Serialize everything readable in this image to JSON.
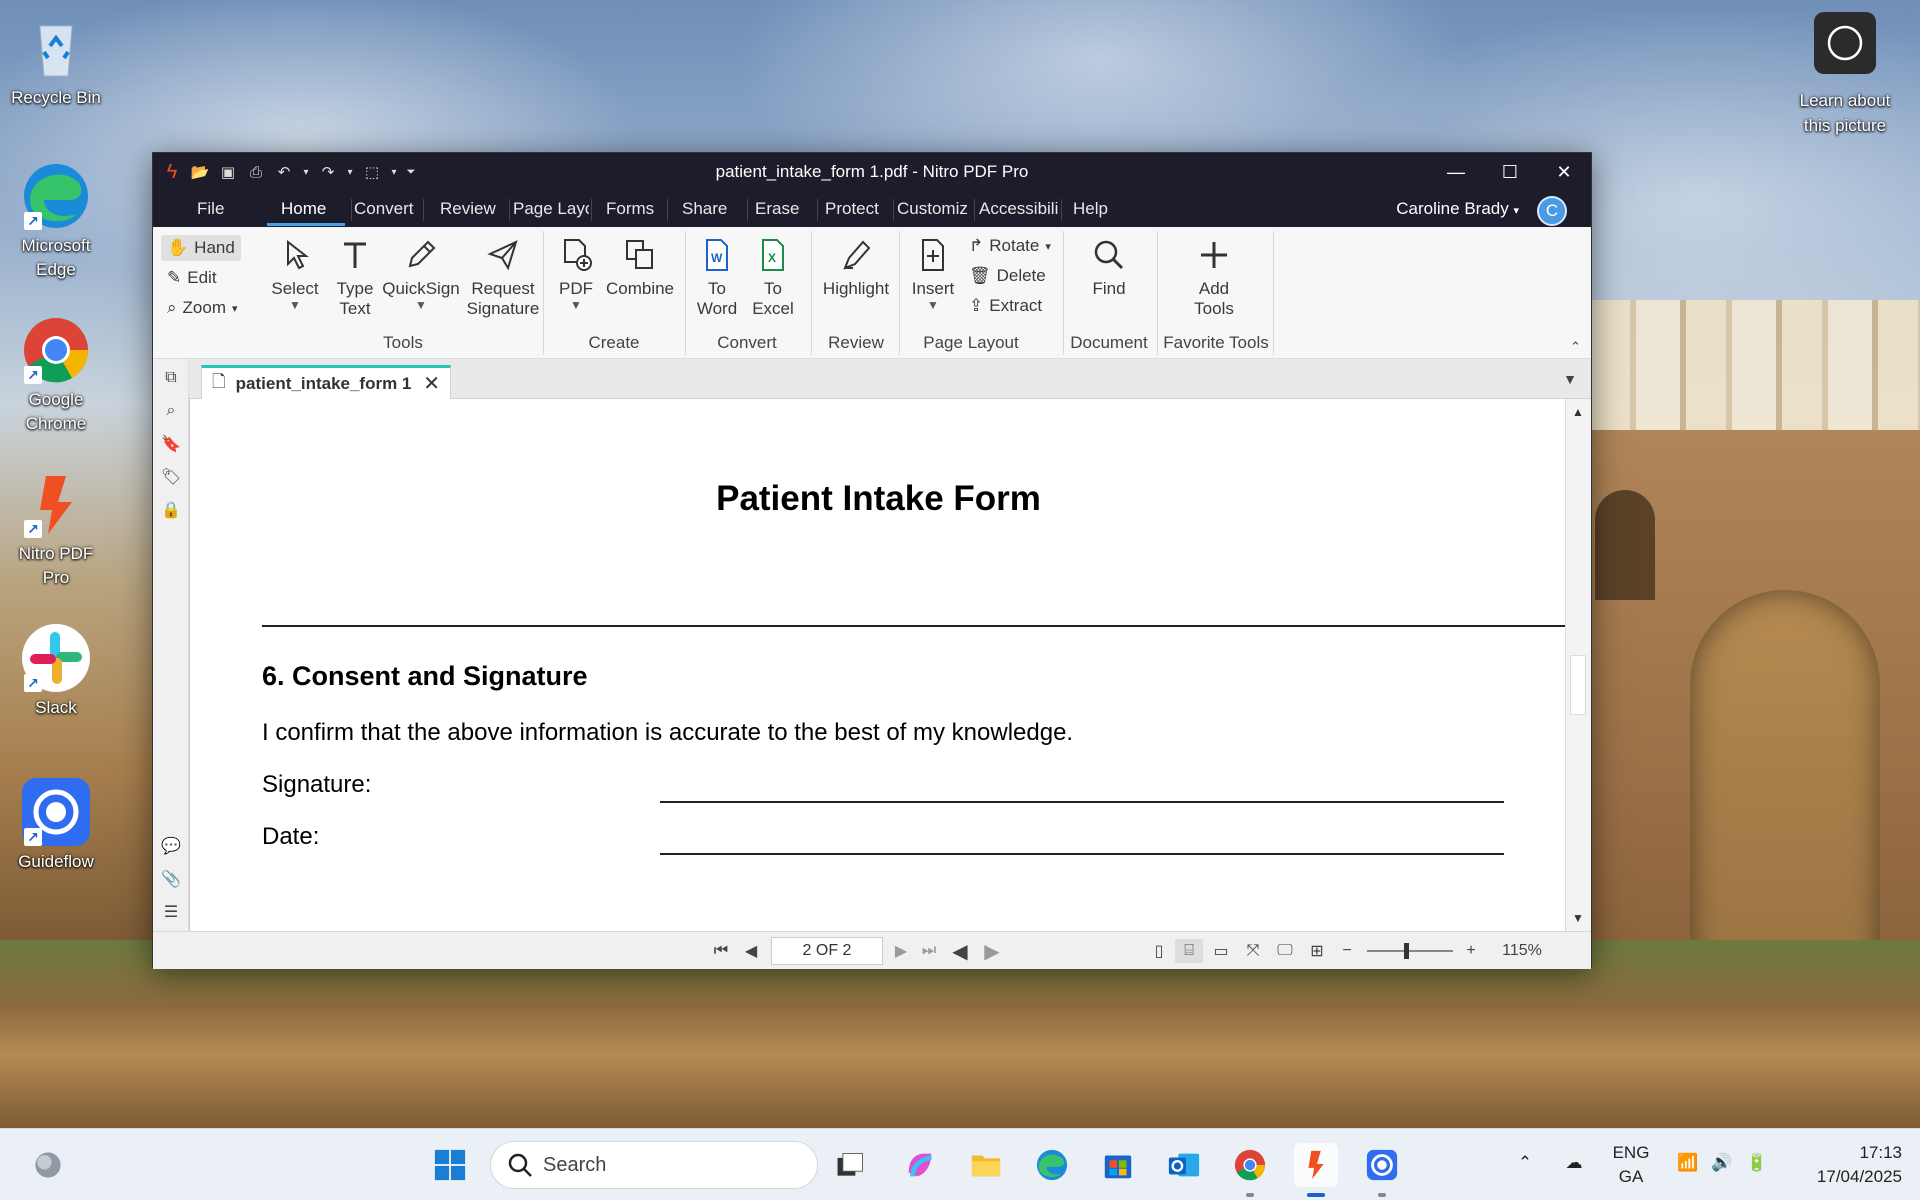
{
  "desktop": {
    "icons": [
      {
        "label": "Recycle Bin"
      },
      {
        "label": "Microsoft Edge"
      },
      {
        "label": "Google Chrome"
      },
      {
        "label": "Nitro PDF Pro"
      },
      {
        "label": "Slack"
      },
      {
        "label": "Guideflow"
      }
    ],
    "learn": {
      "label_line1": "Learn about",
      "label_line2": "this picture"
    }
  },
  "window": {
    "title": "patient_intake_form 1.pdf - Nitro PDF Pro",
    "menu": [
      "File",
      "Home",
      "Convert",
      "Review",
      "Page Layc",
      "Forms",
      "Share",
      "Erase",
      "Protect",
      "Customiz",
      "Accessibili",
      "Help"
    ],
    "active_menu": "Home",
    "user": "Caroline Brady",
    "avatar_initial": "C",
    "ribbon": {
      "hand": "Hand",
      "edit": "Edit",
      "zoom": "Zoom",
      "select": "Select",
      "type_text_1": "Type",
      "type_text_2": "Text",
      "quicksign": "QuickSign",
      "request_sig_1": "Request",
      "request_sig_2": "Signature",
      "pdf": "PDF",
      "combine": "Combine",
      "to_word_1": "To",
      "to_word_2": "Word",
      "to_excel_1": "To",
      "to_excel_2": "Excel",
      "highlight": "Highlight",
      "insert": "Insert",
      "rotate": "Rotate",
      "delete": "Delete",
      "extract": "Extract",
      "find": "Find",
      "add_tools_1": "Add",
      "add_tools_2": "Tools",
      "groups": {
        "tools": "Tools",
        "create": "Create",
        "convert": "Convert",
        "review": "Review",
        "page_layout": "Page Layout",
        "document": "Document",
        "favorite": "Favorite Tools"
      }
    },
    "tab": {
      "name": "patient_intake_form 1"
    },
    "document": {
      "title": "Patient Intake Form",
      "section": "6. Consent and Signature",
      "consent": "I confirm that the above information is accurate to the best of my knowledge.",
      "signature_label": "Signature:",
      "date_label": "Date:"
    },
    "status": {
      "page": "2 OF 2",
      "zoom": "115%",
      "zoom_level": 0.45
    }
  },
  "taskbar": {
    "search_placeholder": "Search",
    "lang_1": "ENG",
    "lang_2": "GA",
    "time": "17:13",
    "date": "17/04/2025"
  },
  "colors": {
    "titlebar": "#1c1c2b",
    "accent": "#4aa0e8",
    "tab_accent": "#27c4b8",
    "nitro": "#f04e23"
  }
}
